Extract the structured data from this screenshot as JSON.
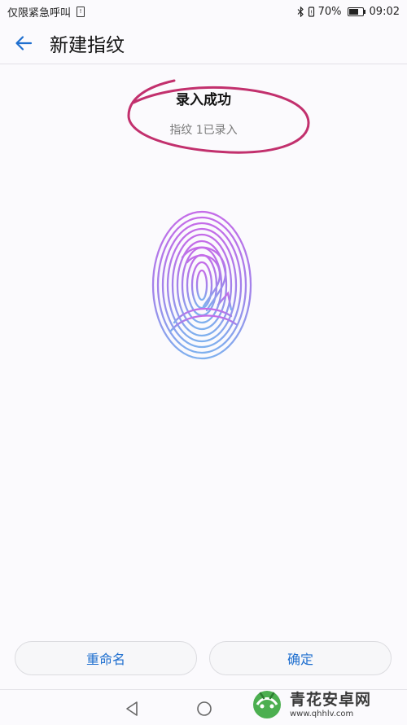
{
  "status_bar": {
    "carrier_text": "仅限紧急呼叫",
    "sim_icon": "sim-card-icon",
    "battery_percent": "70%",
    "time": "09:02",
    "icons": [
      "bluetooth-icon",
      "vibrate-icon",
      "battery-icon"
    ]
  },
  "header": {
    "back_icon": "arrow-left-icon",
    "title": "新建指纹"
  },
  "result": {
    "title": "录入成功",
    "subtitle": "指纹 1已录入"
  },
  "fingerprint": {
    "icon": "fingerprint-icon",
    "gradient_top": "#c46ce8",
    "gradient_bottom": "#7fb0ee"
  },
  "annotation": {
    "color": "#c2306d"
  },
  "buttons": {
    "rename": "重命名",
    "confirm": "确定"
  },
  "nav_bar": {
    "icons": [
      "back-triangle-icon",
      "home-circle-icon"
    ]
  },
  "watermark": {
    "text": "青花安卓网",
    "url": "www.qhhlv.com"
  },
  "colors": {
    "accent": "#1f6fcf",
    "background": "#fbfafd"
  }
}
